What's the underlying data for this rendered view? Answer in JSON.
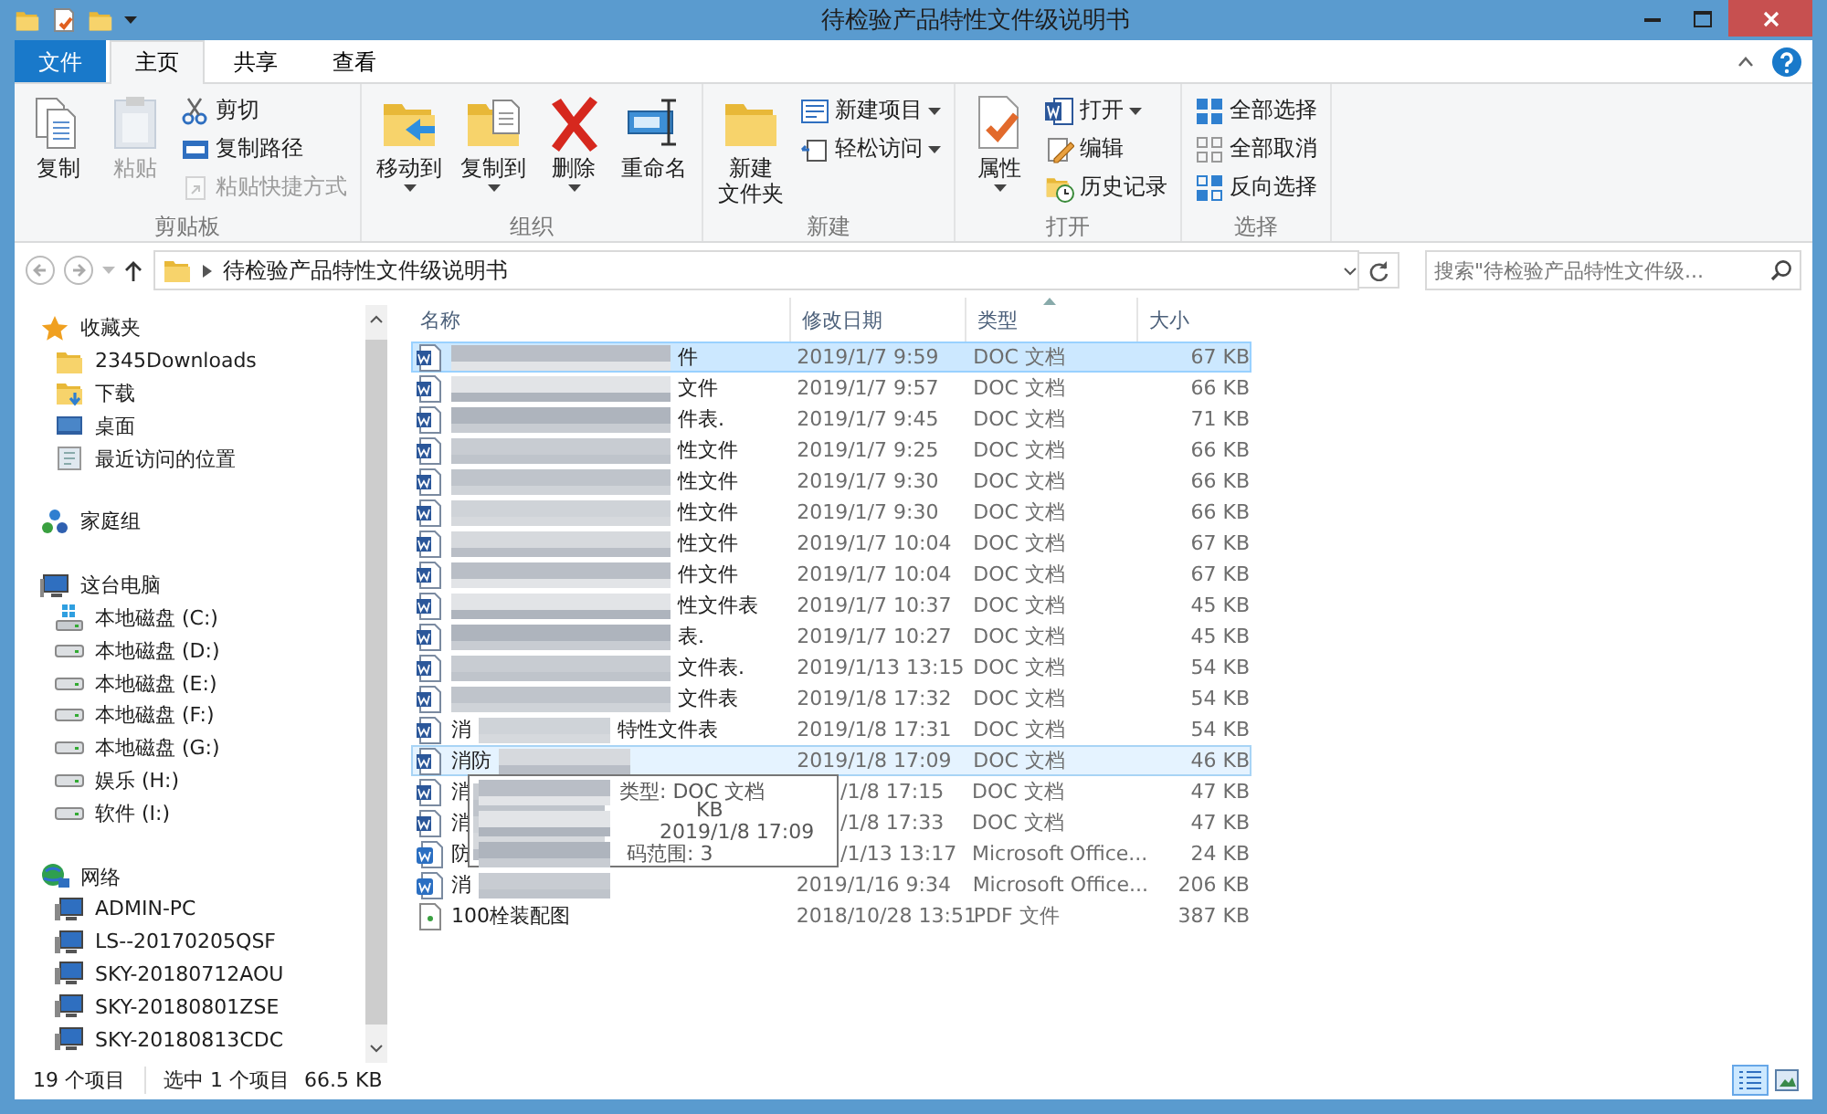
{
  "window": {
    "title": "待检验产品特性文件级说明书"
  },
  "ribbon_tabs": [
    {
      "label": "文件",
      "kind": "file",
      "selected": false
    },
    {
      "label": "主页",
      "kind": "tab",
      "selected": true
    },
    {
      "label": "共享",
      "kind": "tab",
      "selected": false
    },
    {
      "label": "查看",
      "kind": "tab",
      "selected": false
    }
  ],
  "ribbon_groups": [
    {
      "label": "剪贴板",
      "items": [
        {
          "label": "复制",
          "kind": "copy",
          "large": true,
          "disabled": false,
          "menu": false
        },
        {
          "label": "粘贴",
          "kind": "paste",
          "large": true,
          "disabled": true,
          "menu": false
        },
        {
          "label": "剪切",
          "kind": "cut",
          "large": false,
          "disabled": false,
          "menu": false
        },
        {
          "label": "复制路径",
          "kind": "path",
          "large": false,
          "disabled": false,
          "menu": false
        },
        {
          "label": "粘贴快捷方式",
          "kind": "shortcut",
          "large": false,
          "disabled": true,
          "menu": false
        }
      ]
    },
    {
      "label": "组织",
      "items": [
        {
          "label": "移动到",
          "kind": "move",
          "large": true,
          "disabled": false,
          "menu": true
        },
        {
          "label": "复制到",
          "kind": "copyto",
          "large": true,
          "disabled": false,
          "menu": true
        },
        {
          "label": "删除",
          "kind": "delete",
          "large": true,
          "disabled": false,
          "menu": true
        },
        {
          "label": "重命名",
          "kind": "rename",
          "large": true,
          "disabled": false,
          "menu": false
        }
      ]
    },
    {
      "label": "新建",
      "items": [
        {
          "lines": [
            "新建",
            "文件夹"
          ],
          "kind": "folder",
          "large": true,
          "disabled": false,
          "menu": false
        },
        {
          "label": "新建项目",
          "kind": "newitem",
          "large": false,
          "disabled": false,
          "menu": true
        },
        {
          "label": "轻松访问",
          "kind": "easy",
          "large": false,
          "disabled": false,
          "menu": true
        }
      ]
    },
    {
      "label": "打开",
      "items": [
        {
          "label": "属性",
          "kind": "props",
          "large": true,
          "disabled": false,
          "menu": true
        },
        {
          "label": "打开",
          "kind": "word",
          "large": false,
          "disabled": false,
          "menu": true
        },
        {
          "label": "编辑",
          "kind": "edit",
          "large": false,
          "disabled": false,
          "menu": false
        },
        {
          "label": "历史记录",
          "kind": "history",
          "large": false,
          "disabled": false,
          "menu": false
        }
      ]
    },
    {
      "label": "选择",
      "items": [
        {
          "label": "全部选择",
          "kind": "selall",
          "large": false,
          "disabled": false,
          "menu": false
        },
        {
          "label": "全部取消",
          "kind": "selnone",
          "large": false,
          "disabled": false,
          "menu": false
        },
        {
          "label": "反向选择",
          "kind": "selinv",
          "large": false,
          "disabled": false,
          "menu": false
        }
      ]
    }
  ],
  "address": {
    "path": "待检验产品特性文件级说明书"
  },
  "search": {
    "placeholder": "搜索\"待检验产品特性文件级..."
  },
  "nav": [
    {
      "label": "收藏夹",
      "kind": "star",
      "children": [
        {
          "label": "2345Downloads",
          "kind": "folder"
        },
        {
          "label": "下载",
          "kind": "download"
        },
        {
          "label": "桌面",
          "kind": "desktop"
        },
        {
          "label": "最近访问的位置",
          "kind": "recent"
        }
      ]
    },
    {
      "label": "家庭组",
      "kind": "homegroup"
    },
    {
      "label": "这台电脑",
      "kind": "pc",
      "children": [
        {
          "label": "本地磁盘 (C:)",
          "kind": "sysdrive"
        },
        {
          "label": "本地磁盘 (D:)",
          "kind": "drive"
        },
        {
          "label": "本地磁盘 (E:)",
          "kind": "drive"
        },
        {
          "label": "本地磁盘 (F:)",
          "kind": "drive"
        },
        {
          "label": "本地磁盘 (G:)",
          "kind": "drive"
        },
        {
          "label": "娱乐 (H:)",
          "kind": "drive"
        },
        {
          "label": "软件 (I:)",
          "kind": "drive"
        }
      ]
    },
    {
      "label": "网络",
      "kind": "network",
      "children": [
        {
          "label": "ADMIN-PC",
          "kind": "computer"
        },
        {
          "label": "LS--20170205QSF",
          "kind": "computer"
        },
        {
          "label": "SKY-20180712AOU",
          "kind": "computer"
        },
        {
          "label": "SKY-20180801ZSE",
          "kind": "computer"
        },
        {
          "label": "SKY-20180813CDC",
          "kind": "computer"
        }
      ]
    }
  ],
  "columns": [
    {
      "label": "名称",
      "sorted": false
    },
    {
      "label": "修改日期",
      "sorted": false
    },
    {
      "label": "类型",
      "sorted": true
    },
    {
      "label": "大小",
      "sorted": false
    }
  ],
  "files": [
    {
      "name_end": "件",
      "date": "2019/1/7 9:59",
      "type": "DOC 文档",
      "size": "67 KB",
      "kind": "doc",
      "masked": true,
      "selected": true,
      "hover": false
    },
    {
      "name_end": "文件",
      "date": "2019/1/7 9:57",
      "type": "DOC 文档",
      "size": "66 KB",
      "kind": "doc",
      "masked": true,
      "selected": false,
      "hover": false
    },
    {
      "name_end": "件表.",
      "date": "2019/1/7 9:45",
      "type": "DOC 文档",
      "size": "71 KB",
      "kind": "doc",
      "masked": true,
      "selected": false,
      "hover": false
    },
    {
      "name_end": "性文件",
      "date": "2019/1/7 9:25",
      "type": "DOC 文档",
      "size": "66 KB",
      "kind": "doc",
      "masked": true,
      "selected": false,
      "hover": false
    },
    {
      "name_end": "性文件",
      "date": "2019/1/7 9:30",
      "type": "DOC 文档",
      "size": "66 KB",
      "kind": "doc",
      "masked": true,
      "selected": false,
      "hover": false
    },
    {
      "name_end": "性文件",
      "date": "2019/1/7 9:30",
      "type": "DOC 文档",
      "size": "66 KB",
      "kind": "doc",
      "masked": true,
      "selected": false,
      "hover": false
    },
    {
      "name_end": "性文件",
      "date": "2019/1/7 10:04",
      "type": "DOC 文档",
      "size": "67 KB",
      "kind": "doc",
      "masked": true,
      "selected": false,
      "hover": false
    },
    {
      "name_end": "件文件",
      "date": "2019/1/7 10:04",
      "type": "DOC 文档",
      "size": "67 KB",
      "kind": "doc",
      "masked": true,
      "selected": false,
      "hover": false
    },
    {
      "name_end": "性文件表",
      "date": "2019/1/7 10:37",
      "type": "DOC 文档",
      "size": "45 KB",
      "kind": "doc",
      "masked": true,
      "selected": false,
      "hover": false
    },
    {
      "name_end": "表.",
      "date": "2019/1/7 10:27",
      "type": "DOC 文档",
      "size": "45 KB",
      "kind": "doc",
      "masked": true,
      "selected": false,
      "hover": false
    },
    {
      "name_end": "文件表.",
      "date": "2019/1/13 13:15",
      "type": "DOC 文档",
      "size": "54 KB",
      "kind": "doc",
      "masked": true,
      "selected": false,
      "hover": false
    },
    {
      "name_end": "文件表",
      "date": "2019/1/8 17:32",
      "type": "DOC 文档",
      "size": "54 KB",
      "kind": "doc",
      "masked": true,
      "selected": false,
      "hover": false
    },
    {
      "name_start": "消",
      "name_end": "特性文件表",
      "date": "2019/1/8 17:31",
      "type": "DOC 文档",
      "size": "54 KB",
      "kind": "doc",
      "masked": true,
      "selected": false,
      "hover": false
    },
    {
      "name_start": "消防",
      "date": "2019/1/8 17:09",
      "type": "DOC 文档",
      "size": "46 KB",
      "kind": "doc",
      "masked": true,
      "selected": false,
      "hover": true
    },
    {
      "name_start": "消",
      "date": "/1/8 17:15",
      "type": "DOC 文档",
      "size": "47 KB",
      "kind": "doc",
      "masked": true,
      "selected": false,
      "hover": false
    },
    {
      "name_start": "消",
      "date": "/1/8 17:33",
      "type": "DOC 文档",
      "size": "47 KB",
      "kind": "doc",
      "masked": true,
      "selected": false,
      "hover": false
    },
    {
      "name_start": "防",
      "date": "/1/13 13:17",
      "type": "Microsoft Office...",
      "size": "24 KB",
      "kind": "docx",
      "masked": true,
      "selected": false,
      "hover": false
    },
    {
      "name_start": "消",
      "date": "2019/1/16 9:34",
      "type": "Microsoft Office...",
      "size": "206 KB",
      "kind": "docx",
      "masked": true,
      "selected": false,
      "hover": false
    },
    {
      "name_start": "100栓装配图",
      "date": "2018/10/28 13:51",
      "type": "PDF 文件",
      "size": "387 KB",
      "kind": "pdf",
      "masked": false,
      "selected": false,
      "hover": false
    }
  ],
  "tooltip": {
    "lines": [
      "类型: DOC 文档",
      "KB",
      "2019/1/8 17:09",
      "码范围: 3"
    ]
  },
  "status_bar": {
    "count": "19 个项目",
    "selection": "选中 1 个项目",
    "size": "66.5 KB",
    "views": [
      {
        "kind": "details",
        "selected": true
      },
      {
        "kind": "icons",
        "selected": false
      }
    ]
  }
}
